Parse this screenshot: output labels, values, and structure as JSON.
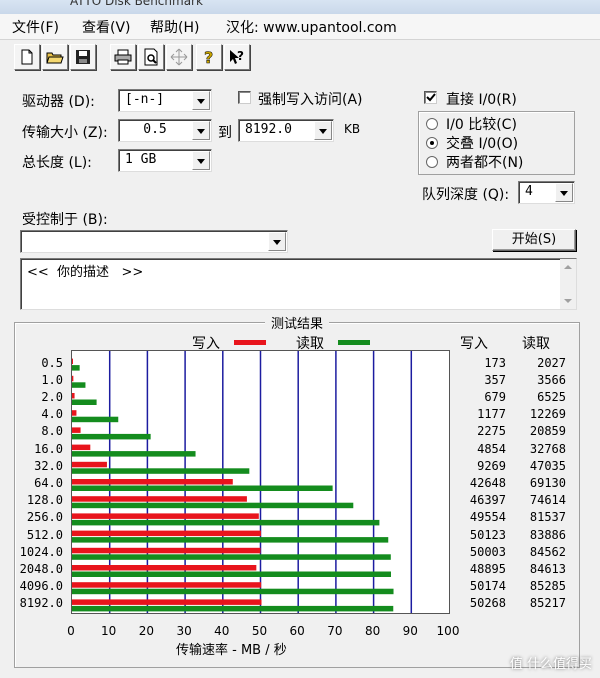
{
  "window": {
    "title_fragment": "ATTO Disk Benchmark"
  },
  "menu": {
    "file": "文件(F)",
    "view": "查看(V)",
    "help": "帮助(H)",
    "localized": "汉化: www.upantool.com"
  },
  "toolbar": {
    "icons": [
      "new-document-icon",
      "open-folder-icon",
      "save-disk-icon",
      "print-icon",
      "print-preview-icon",
      "move-icon",
      "help-icon",
      "context-help-icon"
    ]
  },
  "form": {
    "drive_label": "驱动器 (D):",
    "drive_value": "[-n-]",
    "force_write_label": "强制写入访问(A)",
    "direct_io_label": "直接 I/0(R)",
    "transfer_label": "传输大小 (Z):",
    "transfer_from": "0.5",
    "to_label": "到",
    "transfer_to": "8192.0",
    "kb_label": "KB",
    "total_label": "总长度 (L):",
    "total_value": "1 GB",
    "radio_compare": "I/0 比较(C)",
    "radio_overlap": "交叠 I/0(O)",
    "radio_neither": "两者都不(N)",
    "queue_label": "队列深度 (Q):",
    "queue_value": "4",
    "controlled_label": "受控制于 (B):",
    "controlled_value": "",
    "start_button": "开始(S)",
    "description": "<<  你的描述   >>"
  },
  "results": {
    "group_title": "测试结果",
    "legend_write": "写入",
    "legend_read": "读取",
    "col_write": "写入",
    "col_read": "读取",
    "xlabel": "传输速率 - MB / 秒",
    "colors": {
      "write": "#e8141c",
      "read": "#148c1e",
      "grid": "#1c1ca0"
    }
  },
  "chart_data": {
    "type": "bar",
    "orientation": "horizontal",
    "categories": [
      "0.5",
      "1.0",
      "2.0",
      "4.0",
      "8.0",
      "16.0",
      "32.0",
      "64.0",
      "128.0",
      "256.0",
      "512.0",
      "1024.0",
      "2048.0",
      "4096.0",
      "8192.0"
    ],
    "series": [
      {
        "name": "写入",
        "values": [
          173,
          357,
          679,
          1177,
          2275,
          4854,
          9269,
          42648,
          46397,
          49554,
          50123,
          50003,
          48895,
          50174,
          50268
        ]
      },
      {
        "name": "读取",
        "values": [
          2027,
          3566,
          6525,
          12269,
          20859,
          32768,
          47035,
          69130,
          74614,
          81537,
          83886,
          84562,
          84613,
          85285,
          85217
        ]
      }
    ],
    "x_ticks": [
      "0",
      "10",
      "20",
      "30",
      "40",
      "50",
      "60",
      "70",
      "80",
      "90",
      "100"
    ],
    "xlim": [
      0,
      100
    ],
    "grid": "vertical"
  },
  "watermark": "值 什么值得买"
}
